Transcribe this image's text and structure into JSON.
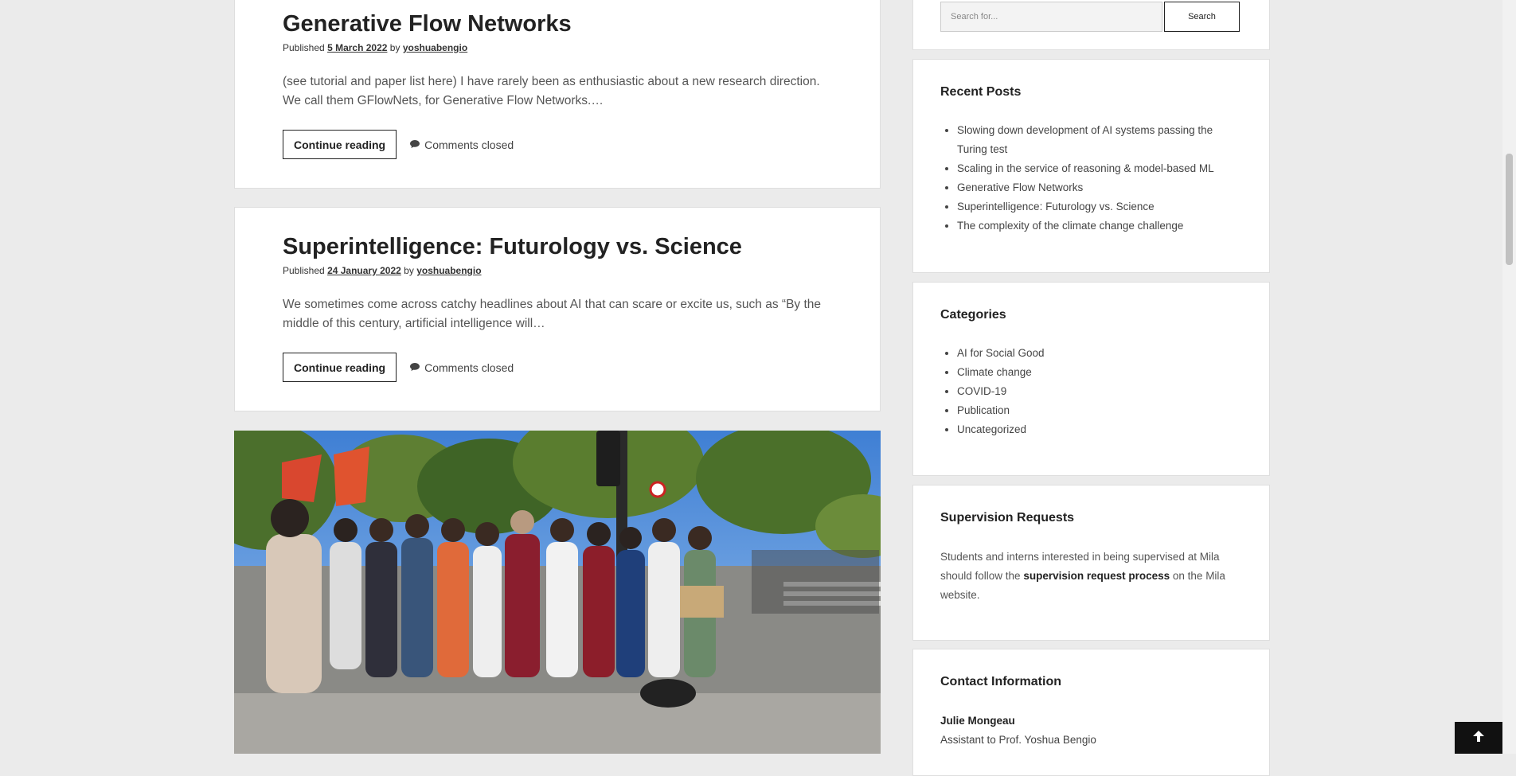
{
  "posts": [
    {
      "title": "Generative Flow Networks",
      "published_label": "Published",
      "date": "5 March 2022",
      "by_label": "by",
      "author": "yoshuabengio",
      "excerpt": "(see tutorial and paper list here) I have rarely been as enthusiastic about a new research direction. We call them GFlowNets, for Generative Flow Networks.…",
      "continue_label": "Continue reading",
      "comments_label": "Comments closed"
    },
    {
      "title": "Superintelligence: Futurology vs. Science",
      "published_label": "Published",
      "date": "24 January 2022",
      "by_label": "by",
      "author": "yoshuabengio",
      "excerpt": "We sometimes come across catchy headlines about AI that can scare or excite us, such as “By the middle of this century, artificial intelligence will…",
      "continue_label": "Continue reading",
      "comments_label": "Comments closed"
    }
  ],
  "sidebar": {
    "search": {
      "placeholder": "Search for...",
      "button_label": "Search"
    },
    "recent_posts": {
      "title": "Recent Posts",
      "items": [
        "Slowing down development of AI systems passing the Turing test",
        "Scaling in the service of reasoning & model-based ML",
        "Generative Flow Networks",
        "Superintelligence: Futurology vs. Science",
        "The complexity of the climate change challenge"
      ]
    },
    "categories": {
      "title": "Categories",
      "items": [
        "AI for Social Good",
        "Climate change",
        "COVID-19",
        "Publication",
        "Uncategorized"
      ]
    },
    "supervision": {
      "title": "Supervision Requests",
      "text_before": "Students and interns interested in being supervised at Mila should follow the ",
      "link": "supervision request process",
      "text_after": " on the Mila website."
    },
    "contact": {
      "title": "Contact Information",
      "name": "Julie Mongeau",
      "role": "Assistant to Prof. Yoshua Bengio"
    }
  },
  "icons": {
    "comment": "speech-bubble-icon",
    "back_to_top": "arrow-up-icon"
  }
}
